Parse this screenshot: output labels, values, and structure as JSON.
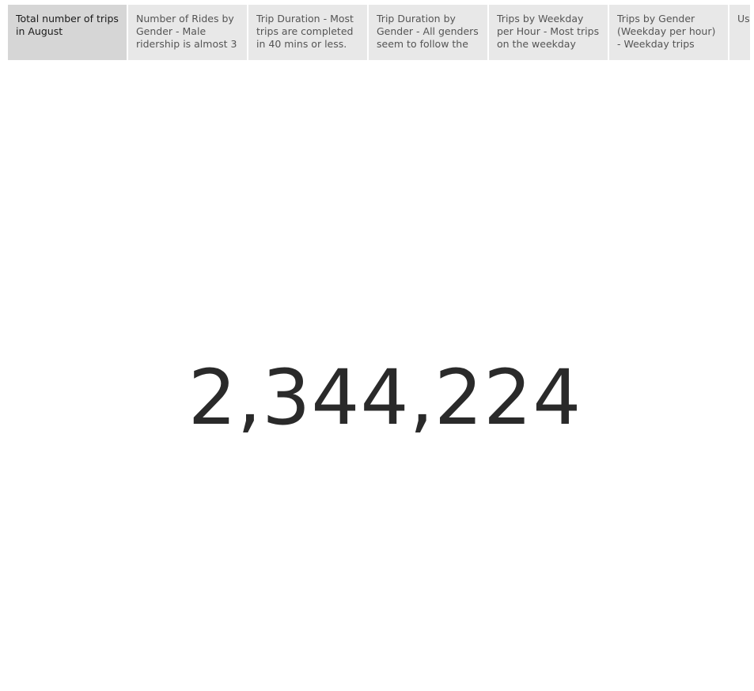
{
  "story": {
    "points": [
      {
        "caption": "Total number of trips in August",
        "active": true
      },
      {
        "caption": "Number of Rides by Gender - Male ridership is almost 3",
        "active": false
      },
      {
        "caption": "Trip Duration - Most trips are completed in 40 mins or less.",
        "active": false
      },
      {
        "caption": "Trip Duration by Gender - All genders seem to follow the",
        "active": false
      },
      {
        "caption": "Trips by Weekday per Hour - Most trips on the weekday occur",
        "active": false
      },
      {
        "caption": "Trips by Gender (Weekday per hour) - Weekday trips seem to",
        "active": false
      },
      {
        "caption": "User by user",
        "active": false
      }
    ]
  },
  "kpi": {
    "value": "2,344,224"
  }
}
